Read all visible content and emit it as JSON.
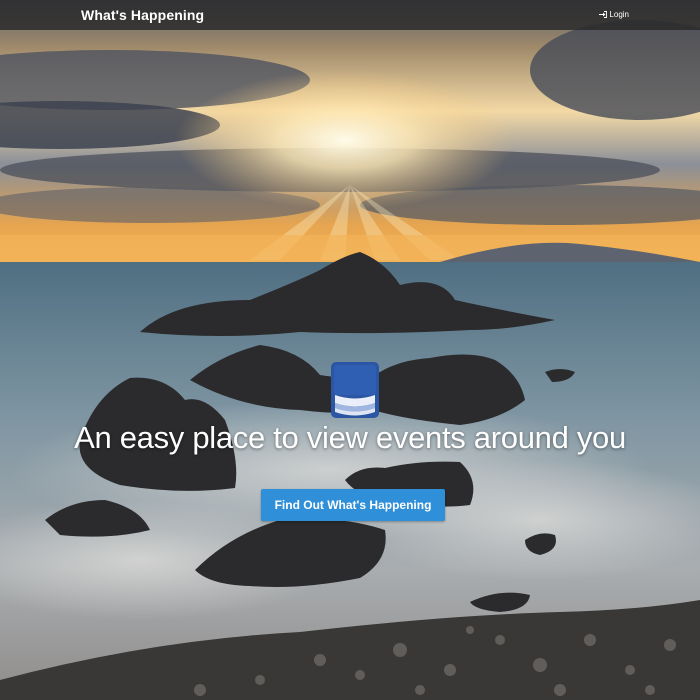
{
  "navbar": {
    "brand": "What's Happening",
    "login_label": "Login",
    "login_icon": "sign-in-icon"
  },
  "hero": {
    "logo_icon": "book-logo-icon",
    "headline": "An easy place to view events around you",
    "cta_label": "Find Out What's Happening"
  },
  "colors": {
    "navbar_bg": "#2a2a2a",
    "cta_bg": "#2f8fd8",
    "logo_blue": "#2a56a3",
    "text": "#ffffff"
  }
}
